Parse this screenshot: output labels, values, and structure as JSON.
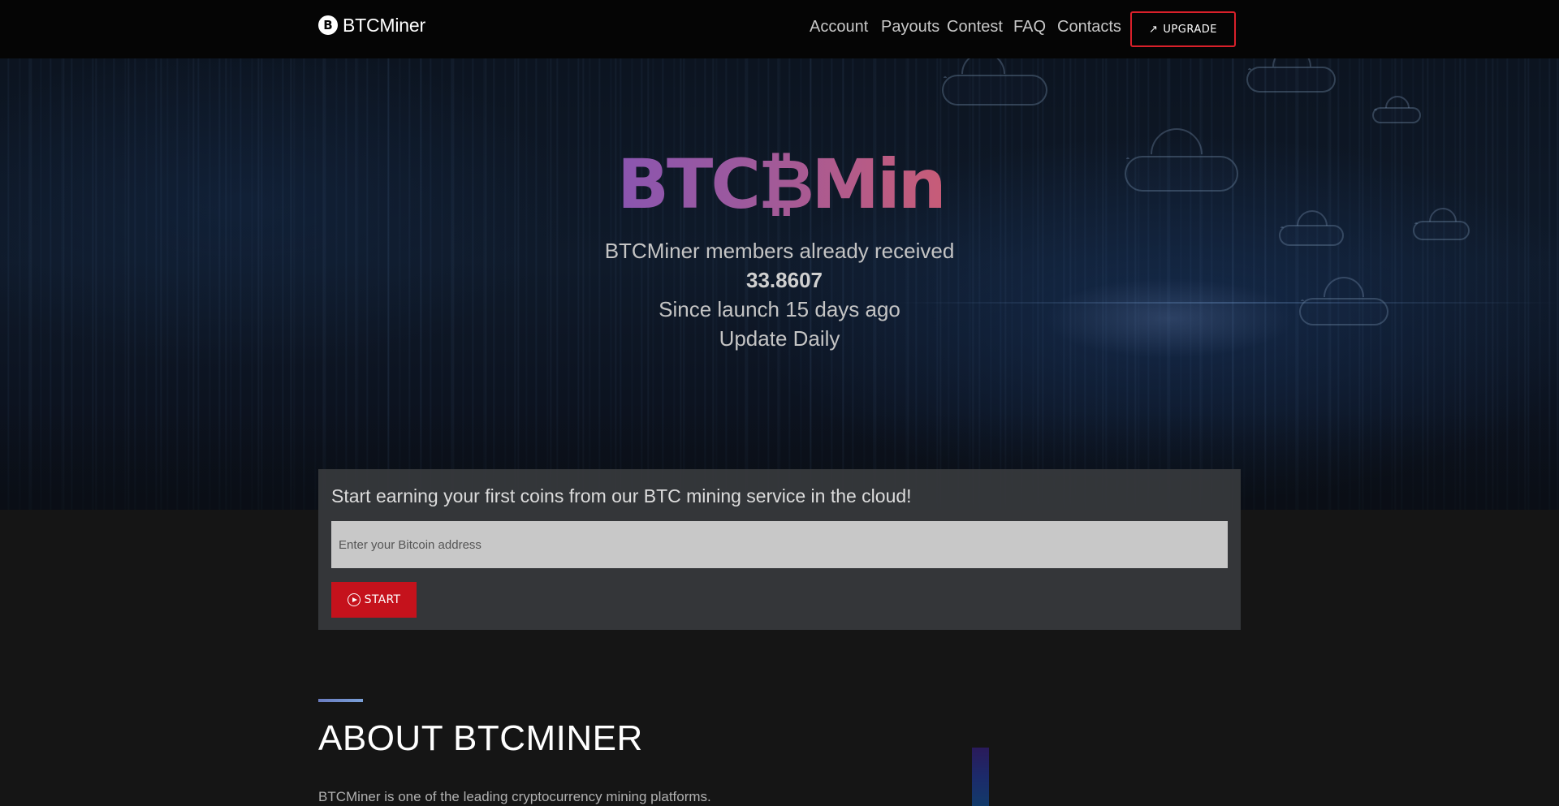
{
  "navbar": {
    "brand_icon": "B",
    "brand": "BTCMiner",
    "links": [
      "Account",
      "Payouts",
      "Contest",
      "FAQ",
      "Contacts"
    ],
    "upgrade_label": "UPGRADE",
    "upgrade_icon": "rocket-icon",
    "accent_color": "#d9202a"
  },
  "hero": {
    "title": "BTC₿Miner",
    "received_text": "BTCMiner members already received",
    "amount": "33.8607",
    "since_text": "Since launch 15 days ago",
    "update_text": "Update Daily"
  },
  "signup": {
    "heading": "Start earning your first coins from our BTC mining service in the cloud!",
    "input_placeholder": "Enter your Bitcoin address",
    "input_value": "",
    "start_label": "START",
    "start_icon": "play-circle-icon",
    "start_color": "#c5121c"
  },
  "about": {
    "title": "ABOUT BTCMINER",
    "text": "BTCMiner is one of the leading cryptocurrency mining platforms."
  }
}
